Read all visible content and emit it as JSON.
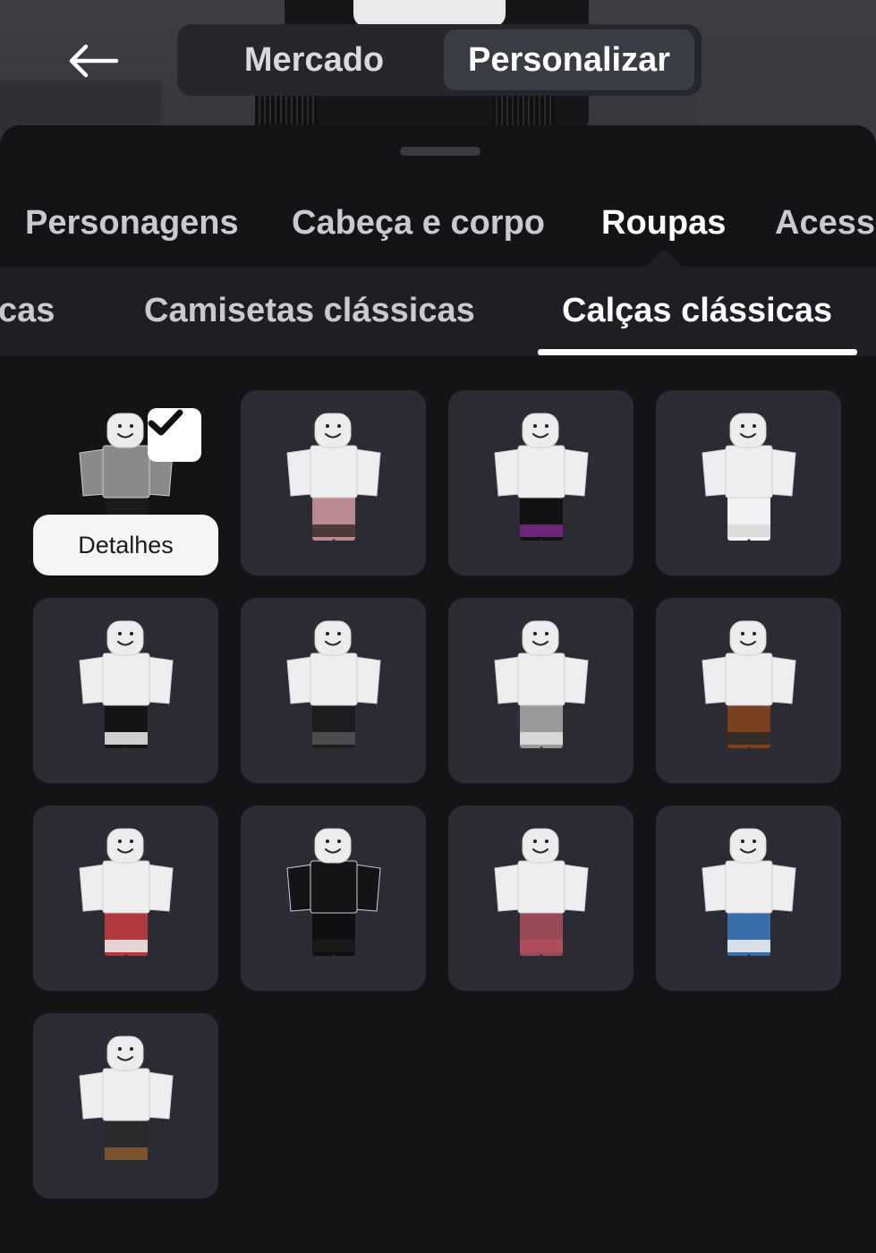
{
  "header": {
    "back_icon": "arrow-left-icon",
    "tabs": [
      {
        "label": "Mercado",
        "active": false
      },
      {
        "label": "Personalizar",
        "active": true
      }
    ]
  },
  "categories": [
    {
      "label": "Personagens",
      "active": false
    },
    {
      "label": "Cabeça e corpo",
      "active": false
    },
    {
      "label": "Roupas",
      "active": true
    },
    {
      "label": "Acess",
      "active": false
    }
  ],
  "subcategories": [
    {
      "label": "cas",
      "active": false
    },
    {
      "label": "Camisetas clássicas",
      "active": false
    },
    {
      "label": "Calças clássicas",
      "active": true
    }
  ],
  "items": [
    {
      "pants": [
        "#1a1a1c",
        "#e6e6e6"
      ],
      "shirt": "#8a8a8c",
      "selected": true
    },
    {
      "pants": [
        "#b98a90",
        "#3a2a2c"
      ],
      "shirt": "#eeeeee",
      "selected": false
    },
    {
      "pants": [
        "#121214",
        "#7a2c8a"
      ],
      "shirt": "#eeeeee",
      "selected": false
    },
    {
      "pants": [
        "#f2f2f2",
        "#d8d8d8"
      ],
      "shirt": "#eeeeee",
      "selected": false
    },
    {
      "pants": [
        "#151517",
        "#eeeeee"
      ],
      "shirt": "#eeeeee",
      "selected": false
    },
    {
      "pants": [
        "#1c1c1e",
        "#555558"
      ],
      "shirt": "#eeeeee",
      "selected": false
    },
    {
      "pants": [
        "#9a9a9c",
        "#e2e2e2"
      ],
      "shirt": "#eeeeee",
      "selected": false
    },
    {
      "pants": [
        "#7a4020",
        "#2a2a2c"
      ],
      "shirt": "#eeeeee",
      "selected": false
    },
    {
      "pants": [
        "#b03a3e",
        "#f0f0f0"
      ],
      "shirt": "#eeeeee",
      "selected": false
    },
    {
      "pants": [
        "#0f0f10",
        "#1a1a1c"
      ],
      "shirt": "#141416",
      "selected": false
    },
    {
      "pants": [
        "#9a4a56",
        "#b05060"
      ],
      "shirt": "#eeeeee",
      "selected": false
    },
    {
      "pants": [
        "#3a6ea8",
        "#f2f2f2"
      ],
      "shirt": "#eeeeee",
      "selected": false
    },
    {
      "pants": [
        "#2a2a2c",
        "#8a5a30"
      ],
      "shirt": "#eeeeee",
      "selected": false
    }
  ],
  "details_label": "Detalhes",
  "check_icon": "checkmark-icon"
}
